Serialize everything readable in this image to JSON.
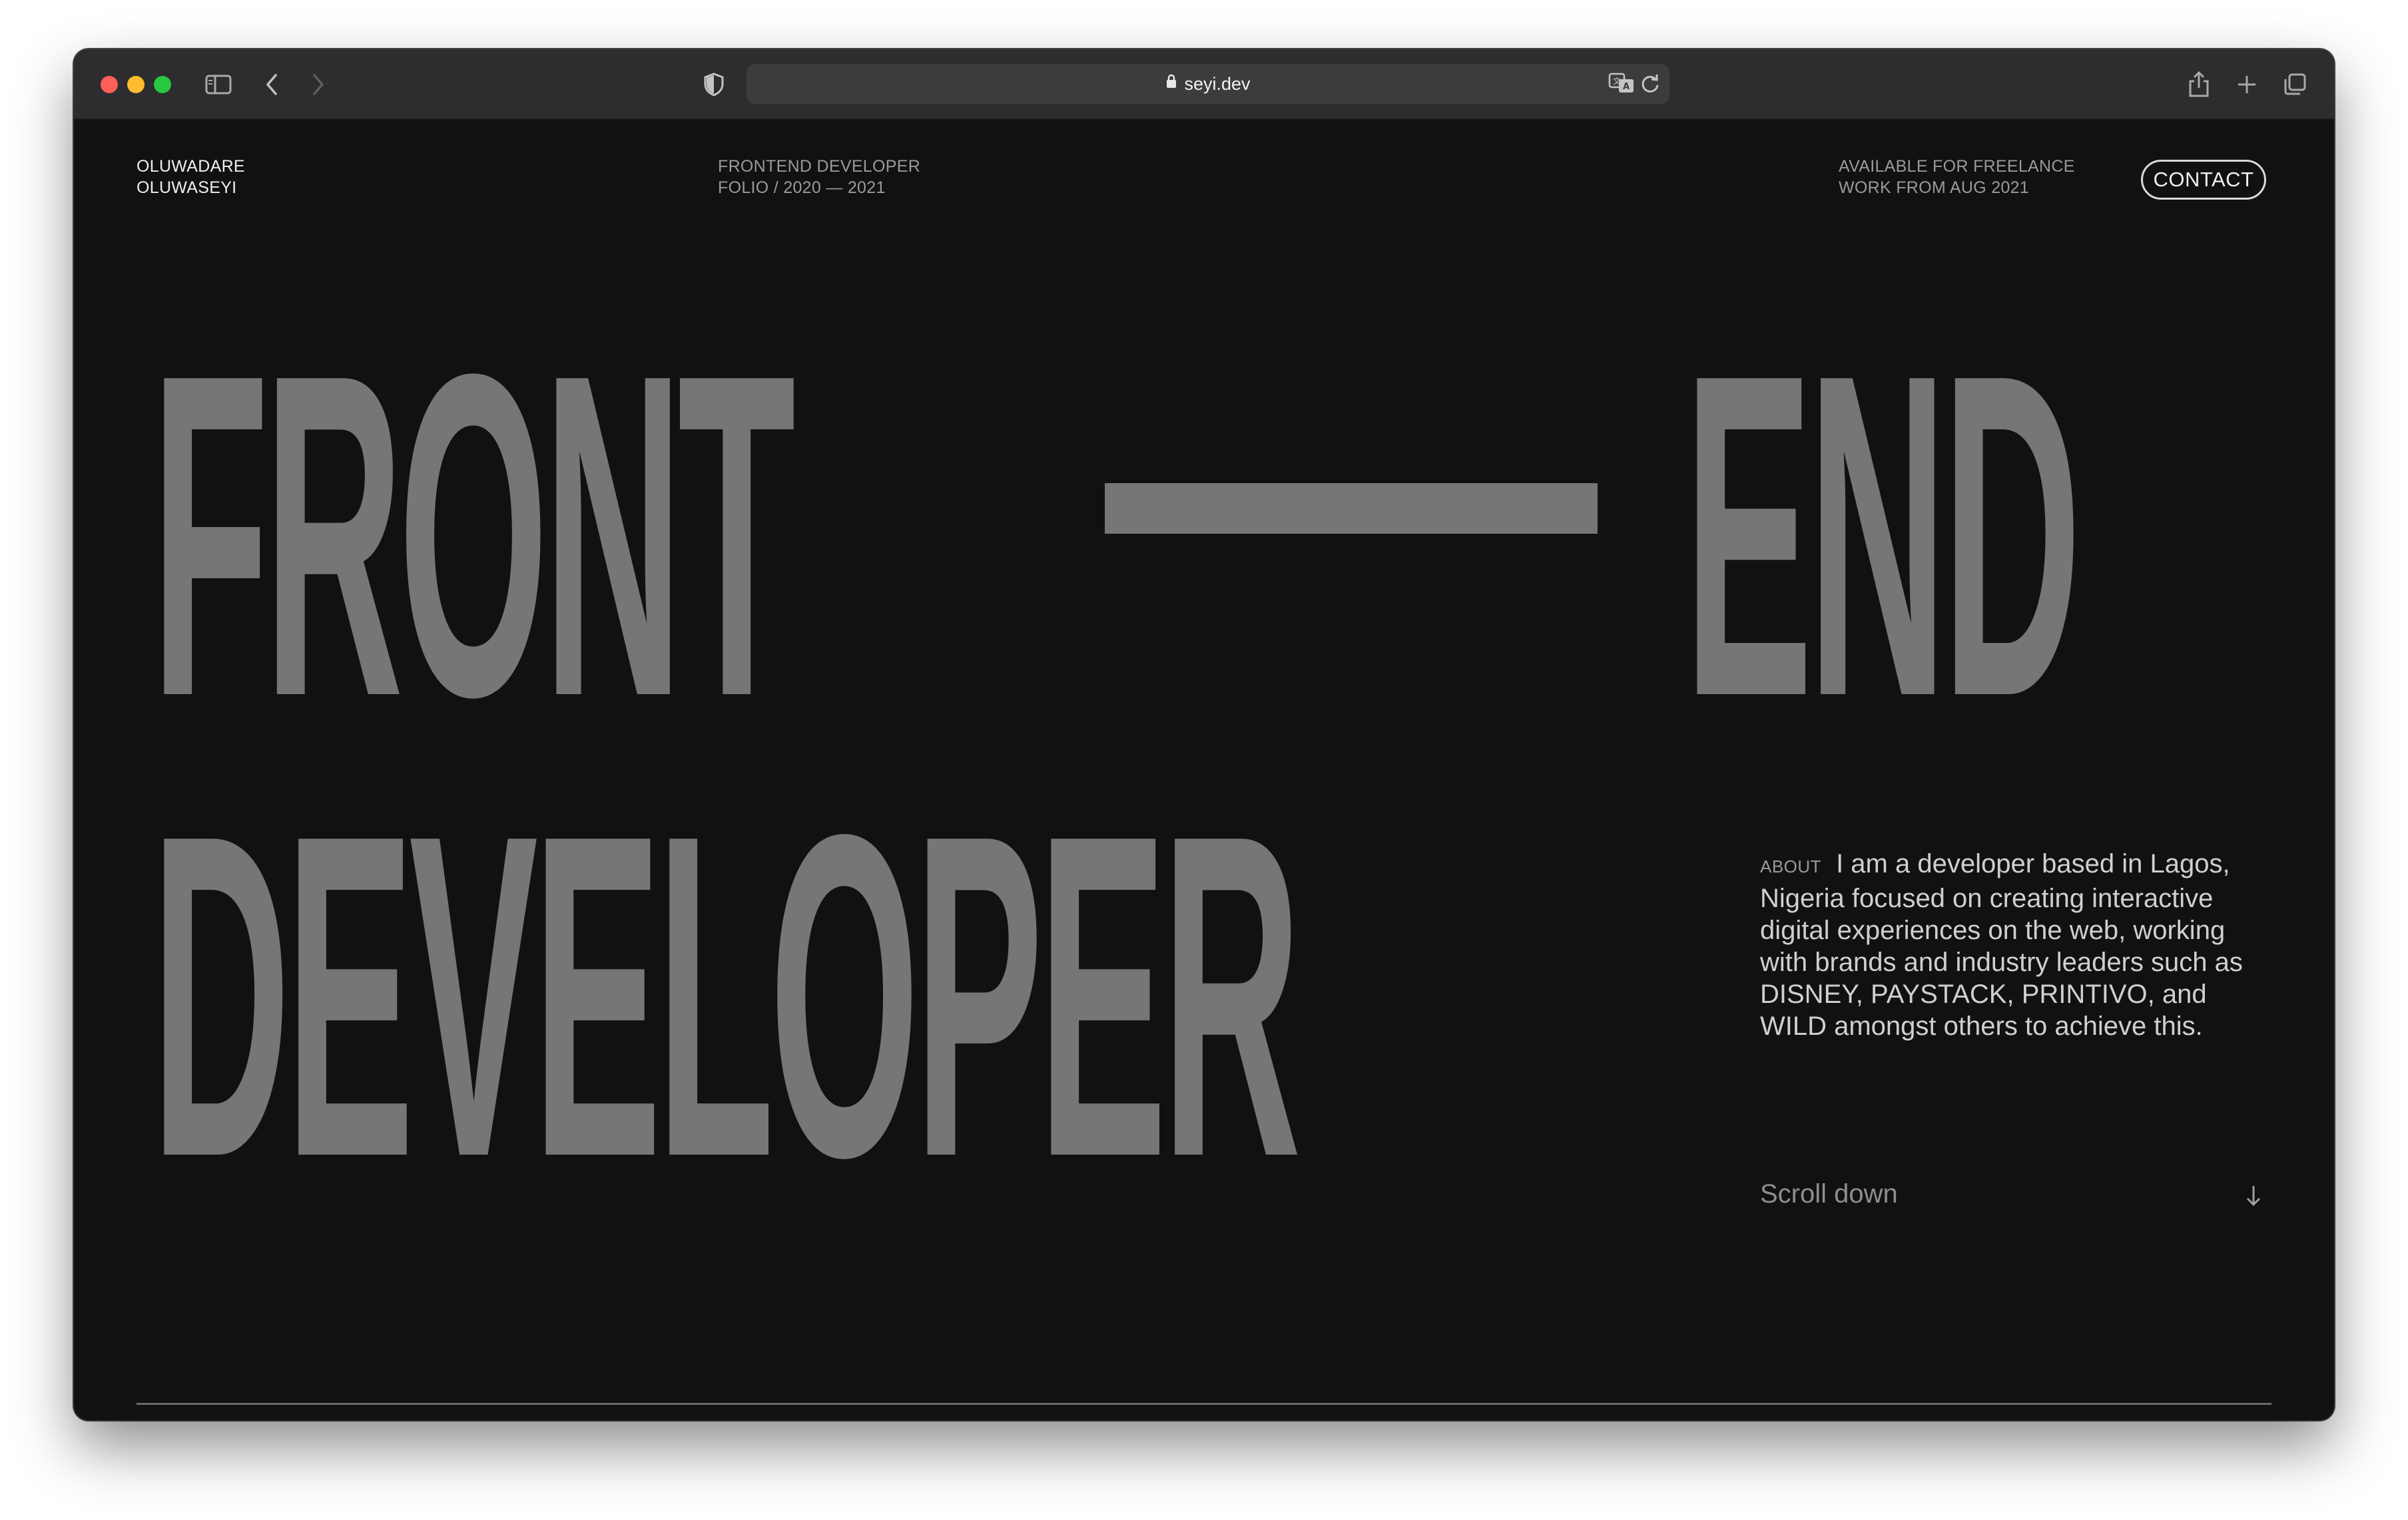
{
  "browser": {
    "url": "seyi.dev",
    "icons": [
      "sidebar-icon",
      "chevron-left-icon",
      "chevron-right-icon",
      "shield-icon",
      "lock-icon",
      "translate-icon",
      "reload-icon",
      "share-icon",
      "plus-icon",
      "tabs-icon"
    ]
  },
  "header": {
    "name_line1": "OLUWADARE",
    "name_line2": "OLUWASEYI",
    "role_line1": "FRONTEND DEVELOPER",
    "role_line2": "FOLIO / 2020 — 2021",
    "availability_line1": "AVAILABLE FOR FREELANCE",
    "availability_line2": "WORK FROM AUG 2021",
    "contact_label": "CONTACT"
  },
  "hero": {
    "word1": "FRONT",
    "word2": "END",
    "word3": "DEVELOPER",
    "color": "#767676"
  },
  "about": {
    "label": "ABOUT",
    "text": "I am a developer based in Lagos, Nigeria focused on creating interactive digital experiences on the web, working with brands and industry leaders such as DISNEY, PAYSTACK, PRINTIVO, and WILD amongst others to achieve this."
  },
  "scroll": {
    "label": "Scroll down",
    "icon": "arrow-down-icon"
  },
  "colors": {
    "background": "#111111",
    "text": "#efefef",
    "muted": "#9a9a9a"
  }
}
